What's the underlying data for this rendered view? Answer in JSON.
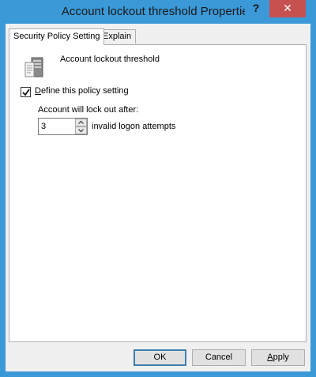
{
  "window": {
    "title": "Account lockout threshold Properties",
    "help_glyph": "?",
    "close_glyph": "✕"
  },
  "tabs": [
    {
      "label": "Security Policy Setting",
      "selected": true
    },
    {
      "label": "Explain",
      "selected": false
    }
  ],
  "policy": {
    "icon": "server-policy-icon",
    "name": "Account lockout threshold",
    "define_checkbox": {
      "checked": true,
      "label_accel": "D",
      "label_rest": "efine this policy setting"
    },
    "lockout_label": "Account will lock out after:",
    "threshold_value": "3",
    "threshold_suffix": "invalid logon attempts"
  },
  "buttons": {
    "ok": "OK",
    "cancel": "Cancel",
    "apply_accel": "A",
    "apply_rest": "pply"
  },
  "colors": {
    "titlebar": "#3b99d8",
    "close_button": "#c75050",
    "dialog_background": "#f0f0f0",
    "panel_background": "#ffffff",
    "default_button_border": "#3c7fb1"
  }
}
